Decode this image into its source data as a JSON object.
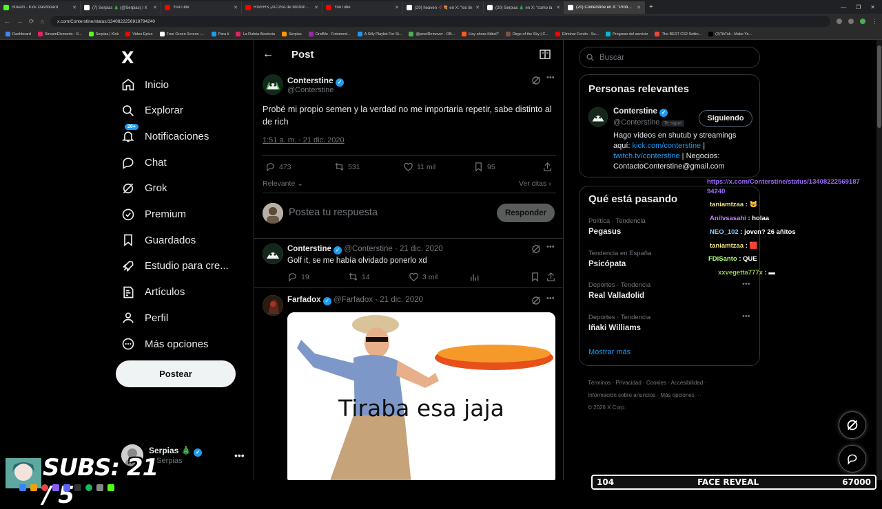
{
  "browser": {
    "tabs": [
      {
        "title": "Stream - Kick Dashboard",
        "color": "#53fc18"
      },
      {
        "title": "(7) Serpias 🎄 (@Serpias) / X",
        "color": "#ffffff"
      },
      {
        "title": "YouTube",
        "color": "#ff0000"
      },
      {
        "title": "RIVERS ¡ACUSA de MANIPULAR",
        "color": "#ff0000"
      },
      {
        "title": "YouTube",
        "color": "#ff0000"
      },
      {
        "title": "(20) heaven 🥀💐 en X: \"los lin",
        "color": "#ffffff"
      },
      {
        "title": "(20) Serpias 🎄 en X: \"como la",
        "color": "#ffffff"
      },
      {
        "title": "(20) Conterstine en X: \"Probé m",
        "color": "#ffffff"
      }
    ],
    "url": "x.com/Conterstine/status/1340822256918794240",
    "bookmarks": [
      "Dashboard",
      "StreamElements - S...",
      "Serpias | Kick",
      "Video Epico",
      "Free Green Screen -...",
      "Para ti",
      "La Ruleta Aleatoria",
      "Serpias",
      "GrafMe - Fotomont...",
      "A Silly Playlist For Si...",
      "@janelRemover - OB...",
      "Hay ahora fútbol?",
      "Dirge of the Sky | C...",
      "Eliminar Fondo - Su...",
      "Progreso del servicio",
      "The BEST CS2 Settin...",
      "(2)TikTok - Make Yo..."
    ]
  },
  "sidebar": {
    "logo": "X",
    "notif_badge": "20+",
    "items": [
      {
        "label": "Inicio",
        "icon": "home-icon"
      },
      {
        "label": "Explorar",
        "icon": "search-icon"
      },
      {
        "label": "Notificaciones",
        "icon": "bell-icon"
      },
      {
        "label": "Chat",
        "icon": "chat-icon"
      },
      {
        "label": "Grok",
        "icon": "grok-icon"
      },
      {
        "label": "Premium",
        "icon": "verified-icon"
      },
      {
        "label": "Guardados",
        "icon": "bookmark-icon"
      },
      {
        "label": "Estudio para cre...",
        "icon": "rocket-icon"
      },
      {
        "label": "Artículos",
        "icon": "article-icon"
      },
      {
        "label": "Perfil",
        "icon": "person-icon"
      },
      {
        "label": "Más opciones",
        "icon": "more-icon"
      }
    ],
    "post_button": "Postear",
    "account": {
      "name": "Serpias 🎄",
      "handle": "@Serpias"
    }
  },
  "main": {
    "header_title": "Post",
    "post": {
      "name": "Conterstine",
      "handle": "@Conterstine",
      "text": "Probé mi propio semen y la verdad no me importaria repetir, sabe distinto al de rich",
      "time": "1:51 a. m. · 21 dic. 2020",
      "replies": "473",
      "reposts": "531",
      "likes": "11 mil",
      "bookmarks": "95"
    },
    "relevante": "Relevante",
    "ver_citas": "Ver citas",
    "reply_placeholder": "Postea tu respuesta",
    "reply_button": "Responder",
    "replies": [
      {
        "name": "Conterstine",
        "handle": "@Conterstine",
        "date": "· 21 dic. 2020",
        "text": "Golf it, se me había olvidado ponerlo xd",
        "replies": "19",
        "reposts": "14",
        "likes": "3 mil"
      },
      {
        "name": "Farfadox",
        "handle": "@Farfadox",
        "date": "· 21 dic. 2020",
        "meme_text": "Tiraba esa jaja"
      }
    ]
  },
  "right": {
    "search_placeholder": "Buscar",
    "relevant_title": "Personas relevantes",
    "person": {
      "name": "Conterstine",
      "handle": "@Conterstine",
      "follows_you": "Te sigue",
      "button": "Siguiendo",
      "bio_1": "Hago vídeos en shutub y streamings aquí: ",
      "bio_link1": "kick.com/conterstine",
      "bio_2": " | ",
      "bio_link2": "twitch.tv/conterstine",
      "bio_3": " | Negocios: ContactoConterstine@gmail.com"
    },
    "trends_title": "Qué está pasando",
    "trends": [
      {
        "category": "Política · Tendencia",
        "name": "Pegasus"
      },
      {
        "category": "Tendencia en España",
        "name": "Psicópata"
      },
      {
        "category": "Deportes · Tendencia",
        "name": "Real Valladolid"
      },
      {
        "category": "Deportes · Tendencia",
        "name": "Iñaki Williams"
      }
    ],
    "show_more": "Mostrar más",
    "footer_1": "Términos · Privacidad · Cookies · Accesibilidad ·",
    "footer_2": "Información sobre anuncios · Más opciones ···",
    "footer_3": "© 2026 X Corp."
  },
  "overlay": {
    "chat": [
      {
        "user": "",
        "msg": "https://x.com/Conterstine/status/1340822256918794240",
        "color": "#9b6cff"
      },
      {
        "user": "taniamtzaa",
        "msg": ": 🐱",
        "color": "#f0e68c"
      },
      {
        "user": "Anilvsasahi",
        "msg": ": holaa",
        "color": "#c77dff"
      },
      {
        "user": "NEO_102",
        "msg": ": joven? 26 añitos",
        "color": "#7ec8ff"
      },
      {
        "user": "taniamtzaa",
        "msg": ": 🟥",
        "color": "#f0e68c"
      },
      {
        "user": "FDiSanto",
        "msg": ": QUE",
        "color": "#b4ff7a"
      },
      {
        "user": "xxvegetta777x",
        "msg": ": ▬",
        "color": "#9acd32"
      }
    ],
    "subs": "SUBS: 21 / 5",
    "goal_left": "104",
    "goal_title": "FACE REVEAL",
    "goal_right": "67000"
  }
}
